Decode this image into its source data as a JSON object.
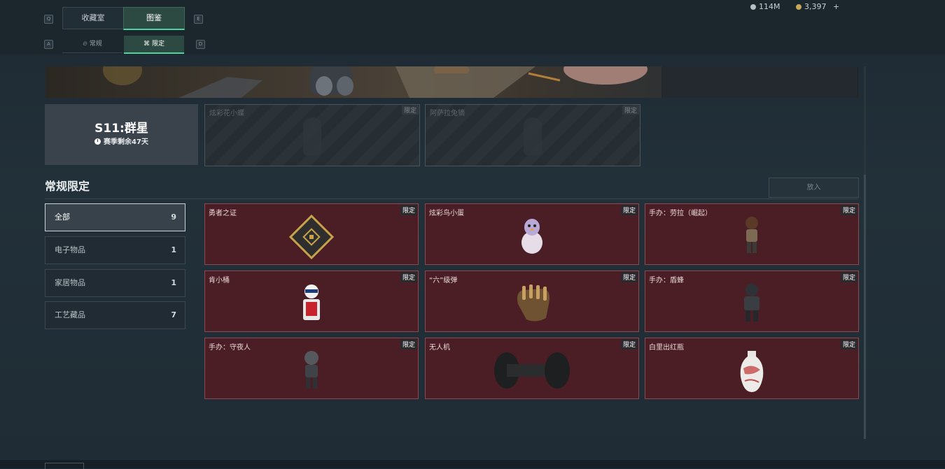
{
  "header": {
    "hint_left": "Q",
    "hint_right": "E",
    "tabs": [
      {
        "label": "收藏室"
      },
      {
        "label": "图鉴"
      }
    ],
    "sub_hint_left": "A",
    "sub_hint_right": "D",
    "subtabs": [
      {
        "label": "常规",
        "icon": "flame-icon"
      },
      {
        "label": "限定",
        "icon": "tag-icon"
      }
    ],
    "currency": [
      {
        "value": "114M",
        "icon": "silver-coin-icon"
      },
      {
        "value": "3,397",
        "icon": "gold-coin-icon",
        "add": "+"
      }
    ]
  },
  "season": {
    "title": "S11:群星",
    "remaining": "赛季剩余47天"
  },
  "locked_items": [
    {
      "name": "炫彩花小蝶",
      "tag": "限定"
    },
    {
      "name": "阿萨拉兔镝",
      "tag": "限定"
    }
  ],
  "section": {
    "title": "常规限定",
    "deposit_label": "放入"
  },
  "filters": [
    {
      "label": "全部",
      "count": "9"
    },
    {
      "label": "电子物品",
      "count": "1"
    },
    {
      "label": "家居物品",
      "count": "1"
    },
    {
      "label": "工艺藏品",
      "count": "7"
    }
  ],
  "items": [
    {
      "name": "勇者之证",
      "tag": "限定",
      "icon": "badge-card-icon"
    },
    {
      "name": "炫彩鸟小蛋",
      "tag": "限定",
      "icon": "egg-bird-icon"
    },
    {
      "name": "手办：劳拉（崛起）",
      "tag": "限定",
      "icon": "figure-lara-icon"
    },
    {
      "name": "肯小桶",
      "tag": "限定",
      "icon": "bucket-figure-icon"
    },
    {
      "name": "“六”级弹",
      "tag": "限定",
      "icon": "bullets-hand-icon"
    },
    {
      "name": "手办：盾蜂",
      "tag": "限定",
      "icon": "figure-armored-icon"
    },
    {
      "name": "手办：守夜人",
      "tag": "限定",
      "icon": "figure-nightwatch-icon"
    },
    {
      "name": "无人机",
      "tag": "限定",
      "icon": "drone-icon"
    },
    {
      "name": "白里出红瓶",
      "tag": "限定",
      "icon": "vase-icon"
    }
  ],
  "colors": {
    "accent": "#4fd3a0",
    "card_bg": "#4a1e24",
    "card_border": "#8a4a50"
  }
}
